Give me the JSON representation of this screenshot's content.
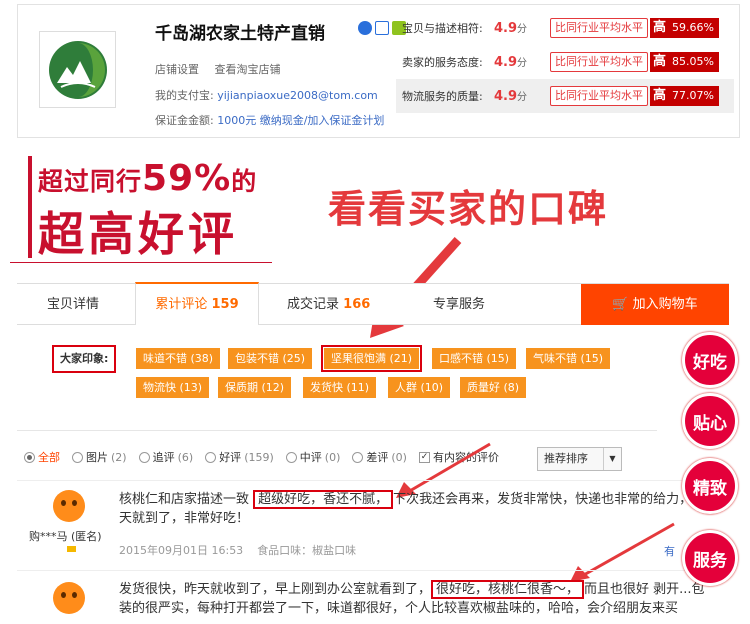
{
  "shop": {
    "name": "千岛湖农家土特产直销",
    "link_settings": "店铺设置",
    "link_view": "查看淘宝店铺",
    "alipay_label": "我的支付宝:",
    "alipay_email": "yijianpiaoxue2008@tom.com",
    "deposit_label": "保证金金额:",
    "deposit_amount": "1000元",
    "deposit_actions": "缴纳现金/加入保证金计划",
    "ratings": [
      {
        "label": "宝贝与描述相符:",
        "score": "4.9",
        "unit": "分",
        "compare": "比同行业平均水平",
        "level": "高",
        "pct": "59.66%"
      },
      {
        "label": "卖家的服务态度:",
        "score": "4.9",
        "unit": "分",
        "compare": "比同行业平均水平",
        "level": "高",
        "pct": "85.05%"
      },
      {
        "label": "物流服务的质量:",
        "score": "4.9",
        "unit": "分",
        "compare": "比同行业平均水平",
        "level": "高",
        "pct": "77.07%"
      }
    ]
  },
  "promo": {
    "line1_a": "超过同行",
    "line1_pct": "59%",
    "line1_b": "的",
    "line2": "超高好评",
    "headline": "看看买家的口碑"
  },
  "tabs": {
    "details": "宝贝详情",
    "reviews": "累计评论",
    "reviews_count": "159",
    "records": "成交记录",
    "records_count": "166",
    "exclusive": "专享服务",
    "cart": "加入购物车"
  },
  "impressions": {
    "label": "大家印象:",
    "tags": [
      "味道不错 (38)",
      "包装不错 (25)",
      "坚果很饱满 (21)",
      "口感不错 (15)",
      "气味不错 (15)",
      "物流快 (13)",
      "保质期 (12)",
      "发货快 (11)",
      "人群 (10)",
      "质量好 (8)"
    ]
  },
  "filter": {
    "items": [
      {
        "label": "全部",
        "count": ""
      },
      {
        "label": "图片",
        "count": "(2)"
      },
      {
        "label": "追评",
        "count": "(6)"
      },
      {
        "label": "好评",
        "count": "(159)"
      },
      {
        "label": "中评",
        "count": "(0)"
      },
      {
        "label": "差评",
        "count": "(0)"
      }
    ],
    "content_only": "有内容的评价",
    "sort": "推荐排序"
  },
  "reviews": [
    {
      "user": "购***马 (匿名)",
      "text_before": "核桃仁和店家描述一致 ",
      "text_hl": "超级好吃，香还不腻，",
      "text_after": "下次我还会再来，发货非常快，快递也非常的给力，三天就到了，非常好吃！",
      "date": "2015年09月01日 16:53",
      "sku": "食品口味：椒盐口味"
    },
    {
      "user": "",
      "text_before": "发货很快，昨天就收到了，早上刚到办公室就看到了，",
      "text_hl": "很好吃，核桃仁很香～，",
      "text_after": "而且也很好 剥开...包装的很严实，每种打开都尝了一下，味道都很好，个人比较喜欢椒盐味的，哈哈，会介绍朋友来买",
      "date": "",
      "sku": ""
    }
  ],
  "has_more": "有",
  "bubbles": [
    "好吃",
    "贴心",
    "精致",
    "服务"
  ],
  "colors": {
    "accent": "#ff4400",
    "tag": "#f7931e",
    "red": "#e4393c",
    "highlight": "#d9000e"
  }
}
